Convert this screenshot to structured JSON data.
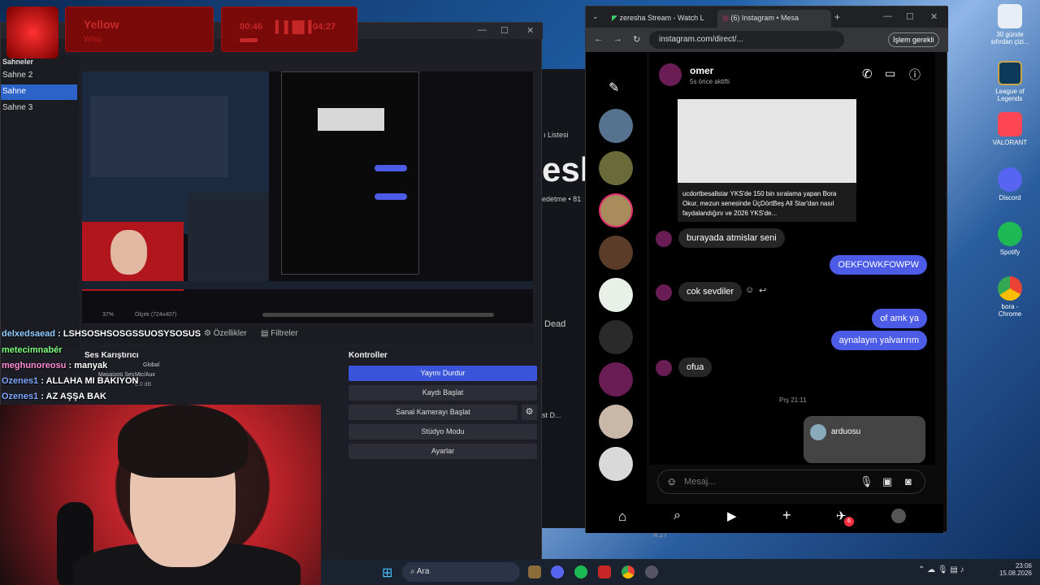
{
  "obs": {
    "scenes_header": "Sahneler",
    "scenes": [
      "Sahne 2",
      "Sahne",
      "Sahne 3"
    ],
    "preview_zoom": "37%",
    "preview_size": "Ölçek (724x407)",
    "properties_label": "Özellikler",
    "filters_label": "Filtreler",
    "mixer_title": "Ses Karıştırıcı",
    "mixer_global": "Global",
    "mixer_tracks": [
      "Masaüstü Ses",
      "Mic/Aux"
    ],
    "mixer_db": "0.0 dB",
    "controls_title": "Kontroller",
    "controls": [
      "Yayını Durdur",
      "Kaydı Başlat",
      "Sanal Kamerayı Başlat",
      "Stüdyo Modu",
      "Ayarlar"
    ]
  },
  "overlay_widgets": {
    "alert_title": "Yellow",
    "alert_sub": "Wisp",
    "timer_left": "00:46",
    "timer_right": "04:27"
  },
  "chat": [
    {
      "user": "delxedsaead",
      "text": ": LSHSOSHSOSGSSUOSYSOSUS"
    },
    {
      "user": "metecimnabér",
      "text": ""
    },
    {
      "user": "meghunoreosu",
      "text": ": manyak"
    },
    {
      "user": "Ozenes1",
      "text": ": ALLAHA MI BAKIYON"
    },
    {
      "user": "Ozenes1",
      "text": ": AZ AŞŞA BAK"
    }
  ],
  "side_strip": {
    "list_label": "ı Listesi",
    "dead_label": "Dead",
    "sed_label": "st D...",
    "time": "4:27",
    "edetme": "edetme • 81"
  },
  "chrome": {
    "tab1": "zeresha Stream - Watch L",
    "tab2": "(6) Instagram • Mesa",
    "url": "instagram.com/direct/...",
    "action_button": "İşlem gerekli"
  },
  "instagram": {
    "contact_name": "omer",
    "contact_status": "5s önce aktifti",
    "post_caption": "ucdortbesallstar YKS'de 150 bin sıralama yapan Bora Okur, mezun senesinde ÜçDörtBeş All Star'dan nasıl faydalandığını ve 2026 YKS'de...",
    "messages": [
      {
        "from": "in",
        "text": "burayada atmislar seni"
      },
      {
        "from": "out",
        "text": "OEKFOWKFOWPW"
      },
      {
        "from": "in",
        "text": "cok sevdiler"
      },
      {
        "from": "out",
        "text": "of amk ya"
      },
      {
        "from": "out",
        "text": "aynalayın yalvarırım"
      },
      {
        "from": "in",
        "text": "ofua"
      }
    ],
    "timestamp": "Prş 21:11",
    "shared_user": "arduosu",
    "composer_placeholder": "Mesaj...",
    "notif_badge": "6"
  },
  "desktop_icons": [
    {
      "label": "30 günde sıfırdan çizi...",
      "color": "#e8eef5"
    },
    {
      "label": "League of Legends",
      "color": "#0b3a5a"
    },
    {
      "label": "VALORANT",
      "color": "#ff4655"
    },
    {
      "label": "Discord",
      "color": "#5865f2"
    },
    {
      "label": "Spotify",
      "color": "#1db954"
    },
    {
      "label": "bora - Chrome",
      "color": "#fbbc04"
    }
  ],
  "taskbar": {
    "search_label": "Ara",
    "clock_time": "23:06",
    "clock_date": "15.08.2026"
  }
}
